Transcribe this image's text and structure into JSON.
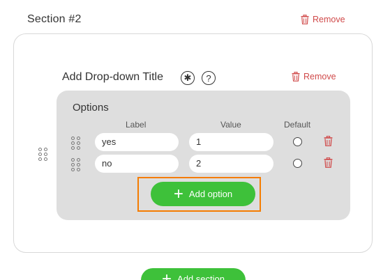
{
  "section": {
    "title": "Section #2",
    "remove_label": "Remove"
  },
  "dropdown": {
    "title": "Add Drop-down Title",
    "required_symbol": "✱",
    "help_symbol": "?",
    "remove_label": "Remove"
  },
  "options": {
    "heading": "Options",
    "columns": {
      "label": "Label",
      "value": "Value",
      "default": "Default"
    },
    "rows": [
      {
        "label": "yes",
        "value": "1",
        "default": false
      },
      {
        "label": "no",
        "value": "2",
        "default": false
      }
    ],
    "add_option_label": "Add option"
  },
  "add_section_label": "Add section",
  "icons": {
    "remove": "trash-icon",
    "drag": "drag-handle-icon",
    "add": "plus-icon",
    "required": "asterisk-icon",
    "help": "question-icon"
  },
  "colors": {
    "accent_green": "#3ec13a",
    "danger_red": "#d04a4a",
    "highlight_orange": "#f57c00",
    "panel_gray": "#dedede"
  }
}
